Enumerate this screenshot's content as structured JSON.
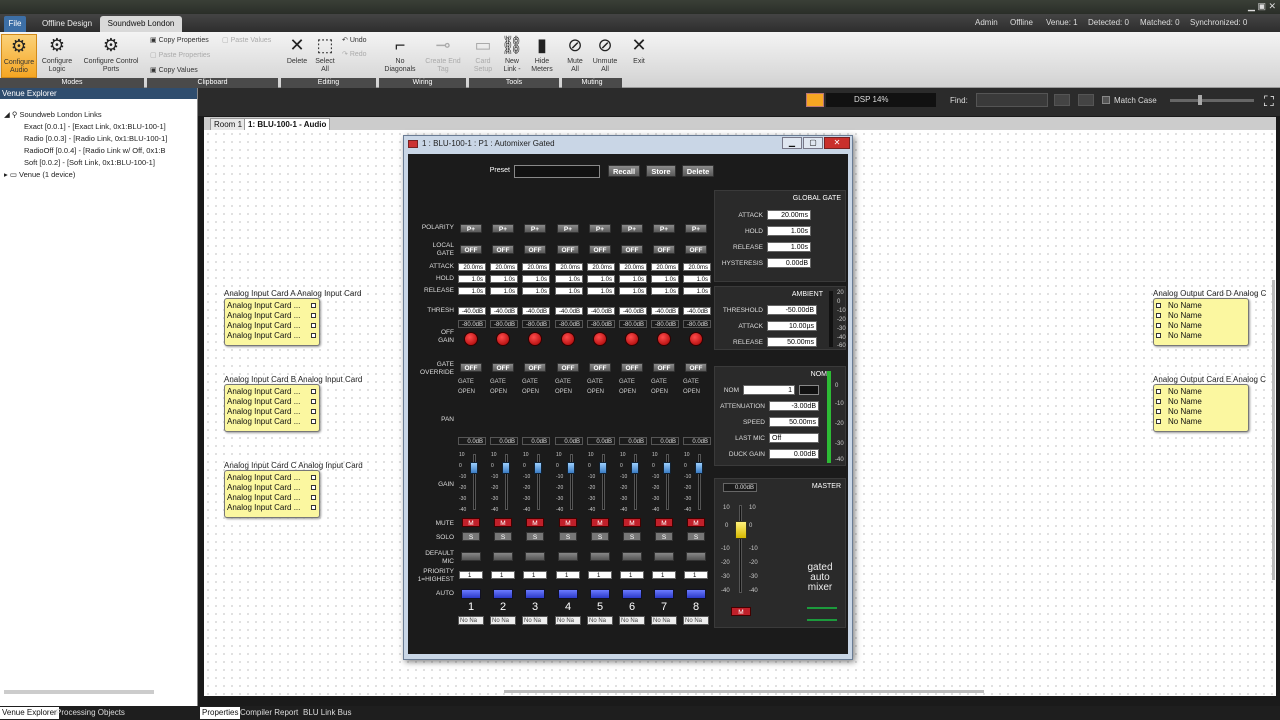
{
  "tabs": {
    "file": "File",
    "offline": "Offline Design",
    "soundweb": "Soundweb London"
  },
  "status": {
    "user": "Admin",
    "mode": "Offline",
    "venue": "Venue: 1",
    "detected": "Detected: 0",
    "matched": "Matched: 0",
    "synced": "Synchronized: 0"
  },
  "ribbon": {
    "configure_audio": "Configure\nAudio",
    "configure_logic": "Configure\nLogic",
    "configure_ports": "Configure Control\nPorts",
    "copy_props": "Copy Properties",
    "paste_props": "Paste Properties",
    "paste_values": "Paste Values",
    "copy_values": "Copy Values",
    "delete": "Delete",
    "select_all": "Select\nAll",
    "undo": "Undo",
    "redo": "Redo",
    "no_diagonals": "No\nDiagonals",
    "create_end_tag": "Create End\nTag",
    "card_setup": "Card\nSetup",
    "new_link": "New\nLink -",
    "hide_meters": "Hide\nMeters",
    "mute_all": "Mute\nAll",
    "unmute_all": "Unmute\nAll",
    "exit": "Exit",
    "groups": [
      "Modes",
      "Clipboard",
      "Editing",
      "Wiring",
      "Tools",
      "Muting"
    ]
  },
  "toolbar2": {
    "dsp": "DSP 14%",
    "find": "Find:",
    "match_case": "Match Case"
  },
  "venue_explorer": {
    "title": "Venue Explorer",
    "root": "Soundweb London Links",
    "items": [
      "Exact   [0.0.1]  -  [Exact Link, 0x1:BLU-100-1]",
      "Radio   [0.0.3]  -  [Radio Link, 0x1:BLU-100-1]",
      "RadioOff  [0.0.4]  -  [Radio Link w/ Off, 0x1:B",
      "Soft   [0.0.2]  -  [Soft Link, 0x1:BLU-100-1]"
    ],
    "venue": "Venue (1 device)"
  },
  "doc_tabs": [
    "Room 1",
    "1: BLU-100-1 - Audio"
  ],
  "bottom_tabs": [
    "Venue Explorer",
    "Processing Objects",
    "Properties",
    "Compiler Report",
    "BLU Link Bus"
  ],
  "blocks": [
    {
      "title": "Analog Input Card A  Analog Input Card",
      "rows": [
        "Analog Input Card ...",
        "Analog Input Card ...",
        "Analog Input Card ...",
        "Analog Input Card ..."
      ]
    },
    {
      "title": "Analog Input Card B  Analog Input Card",
      "rows": [
        "Analog Input Card ...",
        "Analog Input Card ...",
        "Analog Input Card ...",
        "Analog Input Card ..."
      ]
    },
    {
      "title": "Analog Input Card C  Analog Input Card",
      "rows": [
        "Analog Input Card ...",
        "Analog Input Card ...",
        "Analog Input Card ...",
        "Analog Input Card ..."
      ]
    },
    {
      "title": "Analog Output Card D  Analog C",
      "rows": [
        "No Name",
        "No Name",
        "No Name",
        "No Name"
      ]
    },
    {
      "title": "Analog Output Card E  Analog C",
      "rows": [
        "No Name",
        "No Name",
        "No Name",
        "No Name"
      ]
    }
  ],
  "window": {
    "title": "1 : BLU-100-1 : P1 : Automixer Gated",
    "preset": "Preset",
    "recall": "Recall",
    "store": "Store",
    "delete": "Delete",
    "row_labels": {
      "polarity": "POLARITY",
      "local_gate": "LOCAL\nGATE",
      "attack": "ATTACK",
      "hold": "HOLD",
      "release": "RELEASE",
      "thresh": "THRESH",
      "off_gain": "OFF\nGAIN",
      "gate_override": "GATE\nOVERRIDE",
      "pan": "PAN",
      "gain": "GAIN",
      "mute": "MUTE",
      "solo": "SOLO",
      "default_mic": "DEFAULT\nMIC",
      "priority": "PRIORITY\n1=HIGHEST",
      "auto": "AUTO"
    },
    "ch": {
      "polarity": "P+",
      "off": "OFF",
      "attack": "20.0ms",
      "hold": "1.0s",
      "release": "1.0s",
      "thresh": "-40.0dB",
      "offgain": "-80.0dB",
      "gate": "GATE",
      "open": "OPEN",
      "pan": "0.0dB",
      "mute": "M",
      "solo": "S",
      "priority": "1",
      "noname": "No Na"
    },
    "channels": [
      "1",
      "2",
      "3",
      "4",
      "5",
      "6",
      "7",
      "8"
    ],
    "fader_scale": [
      "10",
      "0",
      "-10",
      "-20",
      "-30",
      "-40"
    ],
    "global_gate": {
      "title": "GLOBAL GATE",
      "attack_l": "ATTACK",
      "attack": "20.00ms",
      "hold_l": "HOLD",
      "hold": "1.00s",
      "release_l": "RELEASE",
      "release": "1.00s",
      "hyst_l": "HYSTERESIS",
      "hyst": "0.00dB"
    },
    "ambient": {
      "title": "AMBIENT",
      "thresh_l": "THRESHOLD",
      "thresh": "-50.00dB",
      "attack_l": "ATTACK",
      "attack": "10.00µs",
      "release_l": "RELEASE",
      "release": "50.00ms",
      "scale": [
        "20",
        "0",
        "-10",
        "-20",
        "-30",
        "-40",
        "-60"
      ]
    },
    "nom": {
      "title": "NOM",
      "nom_l": "NOM",
      "nom": "1",
      "att_l": "ATTENUATION",
      "att": "-3.00dB",
      "speed_l": "SPEED",
      "speed": "50.00ms",
      "last_l": "LAST MIC",
      "last": "Off",
      "duck_l": "DUCK GAIN",
      "duck": "0.00dB",
      "scale": [
        "0",
        "-10",
        "-20",
        "-30",
        "-40"
      ]
    },
    "master": {
      "title": "MASTER",
      "value": "0.00dB",
      "mute": "M",
      "scale": [
        "10",
        "0",
        "-10",
        "-20",
        "-30",
        "-40"
      ],
      "brand_1": "gated",
      "brand_2": "auto",
      "brand_3": "mixer"
    }
  }
}
